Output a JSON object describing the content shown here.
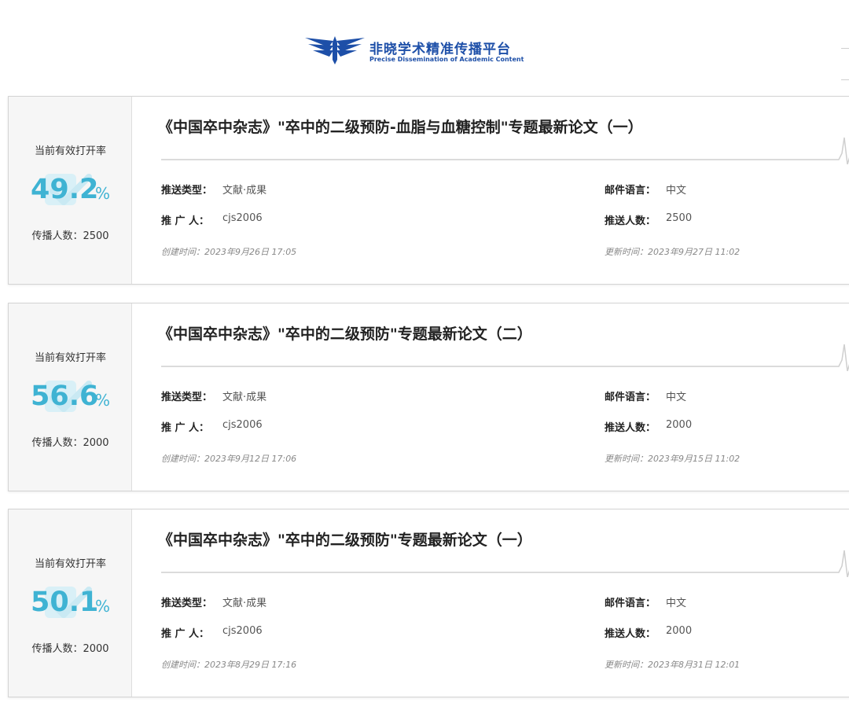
{
  "header": {
    "logo_title": "非晓学术精准传播平台",
    "logo_subtitle": "Precise Dissemination of Academic Content",
    "brand_color": "#1d4fa8"
  },
  "labels": {
    "rate_label": "当前有效打开率",
    "spread_prefix": "传播人数：",
    "push_type": "推送类型：",
    "promoter": "推 广 人：",
    "mail_language": "邮件语言：",
    "push_count": "推送人数：",
    "percent": "%"
  },
  "accent_color": "#3fb3d3",
  "cards": [
    {
      "rate": "49.2",
      "spread_count": "2500",
      "spread_text": "传播人数：2500",
      "title": "《中国卒中杂志》\"卒中的二级预防-血脂与血糖控制\"专题最新论文（一）",
      "push_type": "文献·成果",
      "promoter": "cjs2006",
      "mail_language": "中文",
      "push_count": "2500",
      "created": "创建时间：2023年9月26日 17:05",
      "updated": "更新时间：2023年9月27日 11:02"
    },
    {
      "rate": "56.6",
      "spread_count": "2000",
      "spread_text": "传播人数：2000",
      "title": "《中国卒中杂志》\"卒中的二级预防\"专题最新论文（二）",
      "push_type": "文献·成果",
      "promoter": "cjs2006",
      "mail_language": "中文",
      "push_count": "2000",
      "created": "创建时间：2023年9月12日 17:06",
      "updated": "更新时间：2023年9月15日 11:02"
    },
    {
      "rate": "50.1",
      "spread_count": "2000",
      "spread_text": "传播人数：2000",
      "title": "《中国卒中杂志》\"卒中的二级预防\"专题最新论文（一）",
      "push_type": "文献·成果",
      "promoter": "cjs2006",
      "mail_language": "中文",
      "push_count": "2000",
      "created": "创建时间：2023年8月29日 17:16",
      "updated": "更新时间：2023年8月31日 12:01"
    }
  ]
}
